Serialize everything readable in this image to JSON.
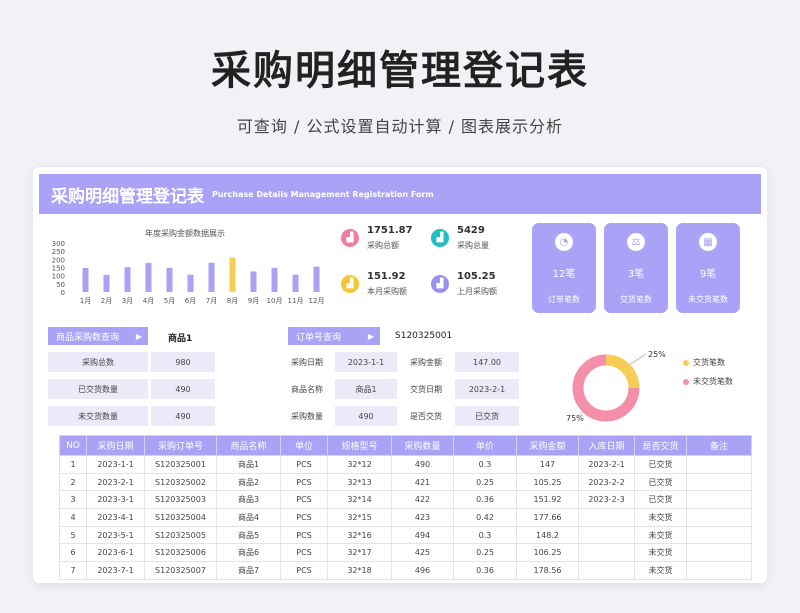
{
  "hero": {
    "title": "采购明细管理登记表",
    "subtitle": "可查询 / 公式设置自动计算 / 图表展示分析"
  },
  "banner": {
    "title_cn": "采购明细管理登记表",
    "title_en": "Purchase Details Management Registration Form"
  },
  "chart_data": {
    "type": "bar",
    "title": "年度采购金额数据展示",
    "categories": [
      "1月",
      "2月",
      "3月",
      "4月",
      "5月",
      "6月",
      "7月",
      "8月",
      "9月",
      "10月",
      "11月",
      "12月"
    ],
    "values": [
      147,
      105,
      152,
      178,
      148,
      106,
      179,
      210,
      126,
      148,
      106,
      155
    ],
    "highlight_index": 7,
    "yticks": [
      0,
      50,
      100,
      150,
      200,
      250,
      300
    ],
    "ylim": [
      0,
      300
    ],
    "colors": {
      "bar": "#a9a2f6",
      "highlight": "#f7cd55"
    }
  },
  "stats": [
    {
      "value": "1751.87",
      "label": "采购总额",
      "icon": "chart-icon",
      "color": "#f07ea1"
    },
    {
      "value": "5429",
      "label": "采购总量",
      "icon": "chart-icon",
      "color": "#1fbec0"
    },
    {
      "value": "151.92",
      "label": "本月采购额",
      "icon": "chart-icon",
      "color": "#f7c532"
    },
    {
      "value": "105.25",
      "label": "上月采购额",
      "icon": "chart-icon",
      "color": "#9a90ef"
    }
  ],
  "tiles": [
    {
      "value": "12笔",
      "label": "订单笔数",
      "icon": "pie-icon"
    },
    {
      "value": "3笔",
      "label": "交货笔数",
      "icon": "scale-icon"
    },
    {
      "value": "9笔",
      "label": "未交货笔数",
      "icon": "calendar-icon"
    }
  ],
  "product_query": {
    "button": "商品采购数查询",
    "value": "商品1",
    "rows": [
      {
        "label": "采购总数",
        "value": "980"
      },
      {
        "label": "已交货数量",
        "value": "490"
      },
      {
        "label": "未交货数量",
        "value": "490"
      }
    ]
  },
  "order_query": {
    "button": "订单号查询",
    "value": "S120325001",
    "rows": [
      {
        "l1": "采购日期",
        "v1": "2023-1-1",
        "l2": "采购金额",
        "v2": "147.00"
      },
      {
        "l1": "商品名称",
        "v1": "商品1",
        "l2": "交货日期",
        "v2": "2023-2-1"
      },
      {
        "l1": "采购数量",
        "v1": "490",
        "l2": "是否交货",
        "v2": "已交货"
      }
    ]
  },
  "donut": {
    "delivered_pct": 25,
    "undelivered_pct": 75,
    "label_delivered": "25%",
    "label_undelivered": "75%",
    "legend_delivered": "交货笔数",
    "legend_undelivered": "未交货笔数",
    "color_delivered": "#f7cd55",
    "color_undelivered": "#f38fa8"
  },
  "table": {
    "headers": [
      "NO",
      "采购日期",
      "采购订单号",
      "商品名称",
      "单位",
      "规格型号",
      "采购数量",
      "单价",
      "采购金额",
      "入库日期",
      "是否交货",
      "备注"
    ],
    "rows": [
      [
        "1",
        "2023-1-1",
        "S120325001",
        "商品1",
        "PCS",
        "32*12",
        "490",
        "0.3",
        "147",
        "2023-2-1",
        "已交货",
        ""
      ],
      [
        "2",
        "2023-2-1",
        "S120325002",
        "商品2",
        "PCS",
        "32*13",
        "421",
        "0.25",
        "105.25",
        "2023-2-2",
        "已交货",
        ""
      ],
      [
        "3",
        "2023-3-1",
        "S120325003",
        "商品3",
        "PCS",
        "32*14",
        "422",
        "0.36",
        "151.92",
        "2023-2-3",
        "已交货",
        ""
      ],
      [
        "4",
        "2023-4-1",
        "S120325004",
        "商品4",
        "PCS",
        "32*15",
        "423",
        "0.42",
        "177.66",
        "",
        "未交货",
        ""
      ],
      [
        "5",
        "2023-5-1",
        "S120325005",
        "商品5",
        "PCS",
        "32*16",
        "494",
        "0.3",
        "148.2",
        "",
        "未交货",
        ""
      ],
      [
        "6",
        "2023-6-1",
        "S120325006",
        "商品6",
        "PCS",
        "32*17",
        "425",
        "0.25",
        "106.25",
        "",
        "未交货",
        ""
      ],
      [
        "7",
        "2023-7-1",
        "S120325007",
        "商品7",
        "PCS",
        "32*18",
        "496",
        "0.36",
        "178.56",
        "",
        "未交货",
        ""
      ]
    ]
  }
}
